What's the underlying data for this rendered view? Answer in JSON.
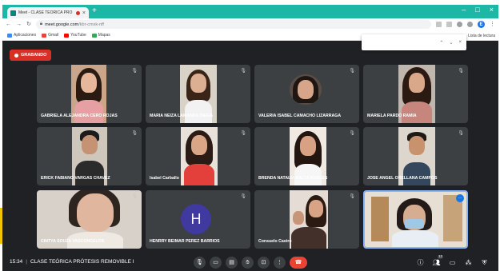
{
  "browser": {
    "tab_title": "Meet - CLASE TEÓRICA PRÓ",
    "url_host": "meet.google.com",
    "url_path": "/kbr-cmxk-nff",
    "bookmarks": [
      {
        "label": "Aplicaciones",
        "color": "#4285f4"
      },
      {
        "label": "Gmail",
        "color": "#ea4335"
      },
      {
        "label": "YouTube",
        "color": "#ff0000"
      },
      {
        "label": "Mapas",
        "color": "#34a853"
      }
    ],
    "reading_list": "Lista de lectura",
    "profile_initial": "E"
  },
  "recording": {
    "label": "GRABANDO"
  },
  "participants": [
    {
      "name": "GABRIELA ALEJANDRA CERO ROJAS"
    },
    {
      "name": "MARIA NEIZA LAMANDA DIEGA"
    },
    {
      "name": "VALERIA ISABEL CAMACHO LIZARRAGA"
    },
    {
      "name": "MARIELA PARDO RAMIA"
    },
    {
      "name": "ERICK FABIANO VARGAS CHAVEZ"
    },
    {
      "name": "Isabel Carballo"
    },
    {
      "name": "BRENDA NATALIA BALTA ROBLES"
    },
    {
      "name": "JOSE ANGEL ORELLANA CAMPOS"
    },
    {
      "name": "CINTYA SOUZA VASCONCELOS"
    },
    {
      "name": "HENRRY BEIMAR PEREZ BARRIOS",
      "initial": "H"
    },
    {
      "name": "Consuelo Castro"
    },
    {
      "name": ""
    }
  ],
  "meeting": {
    "time": "15:34",
    "title": "CLASE TEÓRICA PRÓTESIS REMOVIBLE I",
    "participants_count": "12"
  },
  "colors": {
    "accent": "#1a73e8",
    "end_call": "#ea4335",
    "chrome_tab_strip": "#1db7a6"
  }
}
